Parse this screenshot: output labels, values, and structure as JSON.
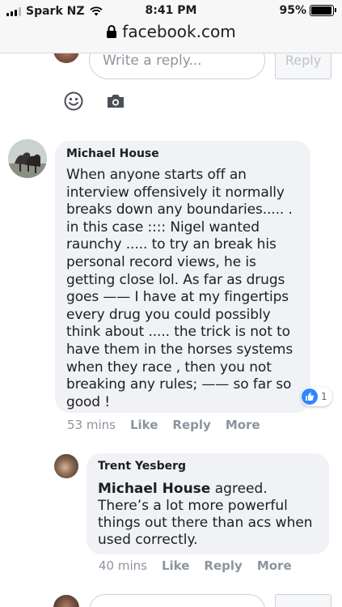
{
  "status_bar": {
    "carrier": "Spark NZ",
    "time": "8:41 PM",
    "battery_percent": "95%",
    "battery_level": 0.95
  },
  "browser": {
    "url": "facebook.com"
  },
  "composer": {
    "placeholder": "Write a reply...",
    "reply_label": "Reply",
    "emoji_icon": "smiley-icon",
    "camera_icon": "camera-icon"
  },
  "comment": {
    "author": "Michael House",
    "text": "When anyone starts off an interview offensively it normally breaks down any boundaries..... . in this case :::: Nigel wanted raunchy ..... to try an break his personal record views, he is getting close lol. As far as drugs goes —— I have at my fingertips every drug you could possibly think about ..... the trick is not to have them in the horses systems when they race , then you not breaking any rules; —— so far so good !",
    "reaction_count": "1",
    "time": "53 mins",
    "like_label": "Like",
    "reply_label": "Reply",
    "more_label": "More"
  },
  "reply": {
    "author": "Trent Yesberg",
    "mention": "Michael House",
    "text": " agreed. There’s a lot more powerful things out there than acs when used correctly.",
    "time": "40 mins",
    "like_label": "Like",
    "reply_label": "Reply",
    "more_label": "More"
  },
  "colors": {
    "bubble": "#f0f2f5",
    "meta_text": "#8d949e",
    "like_blue": "#2d88ff"
  }
}
